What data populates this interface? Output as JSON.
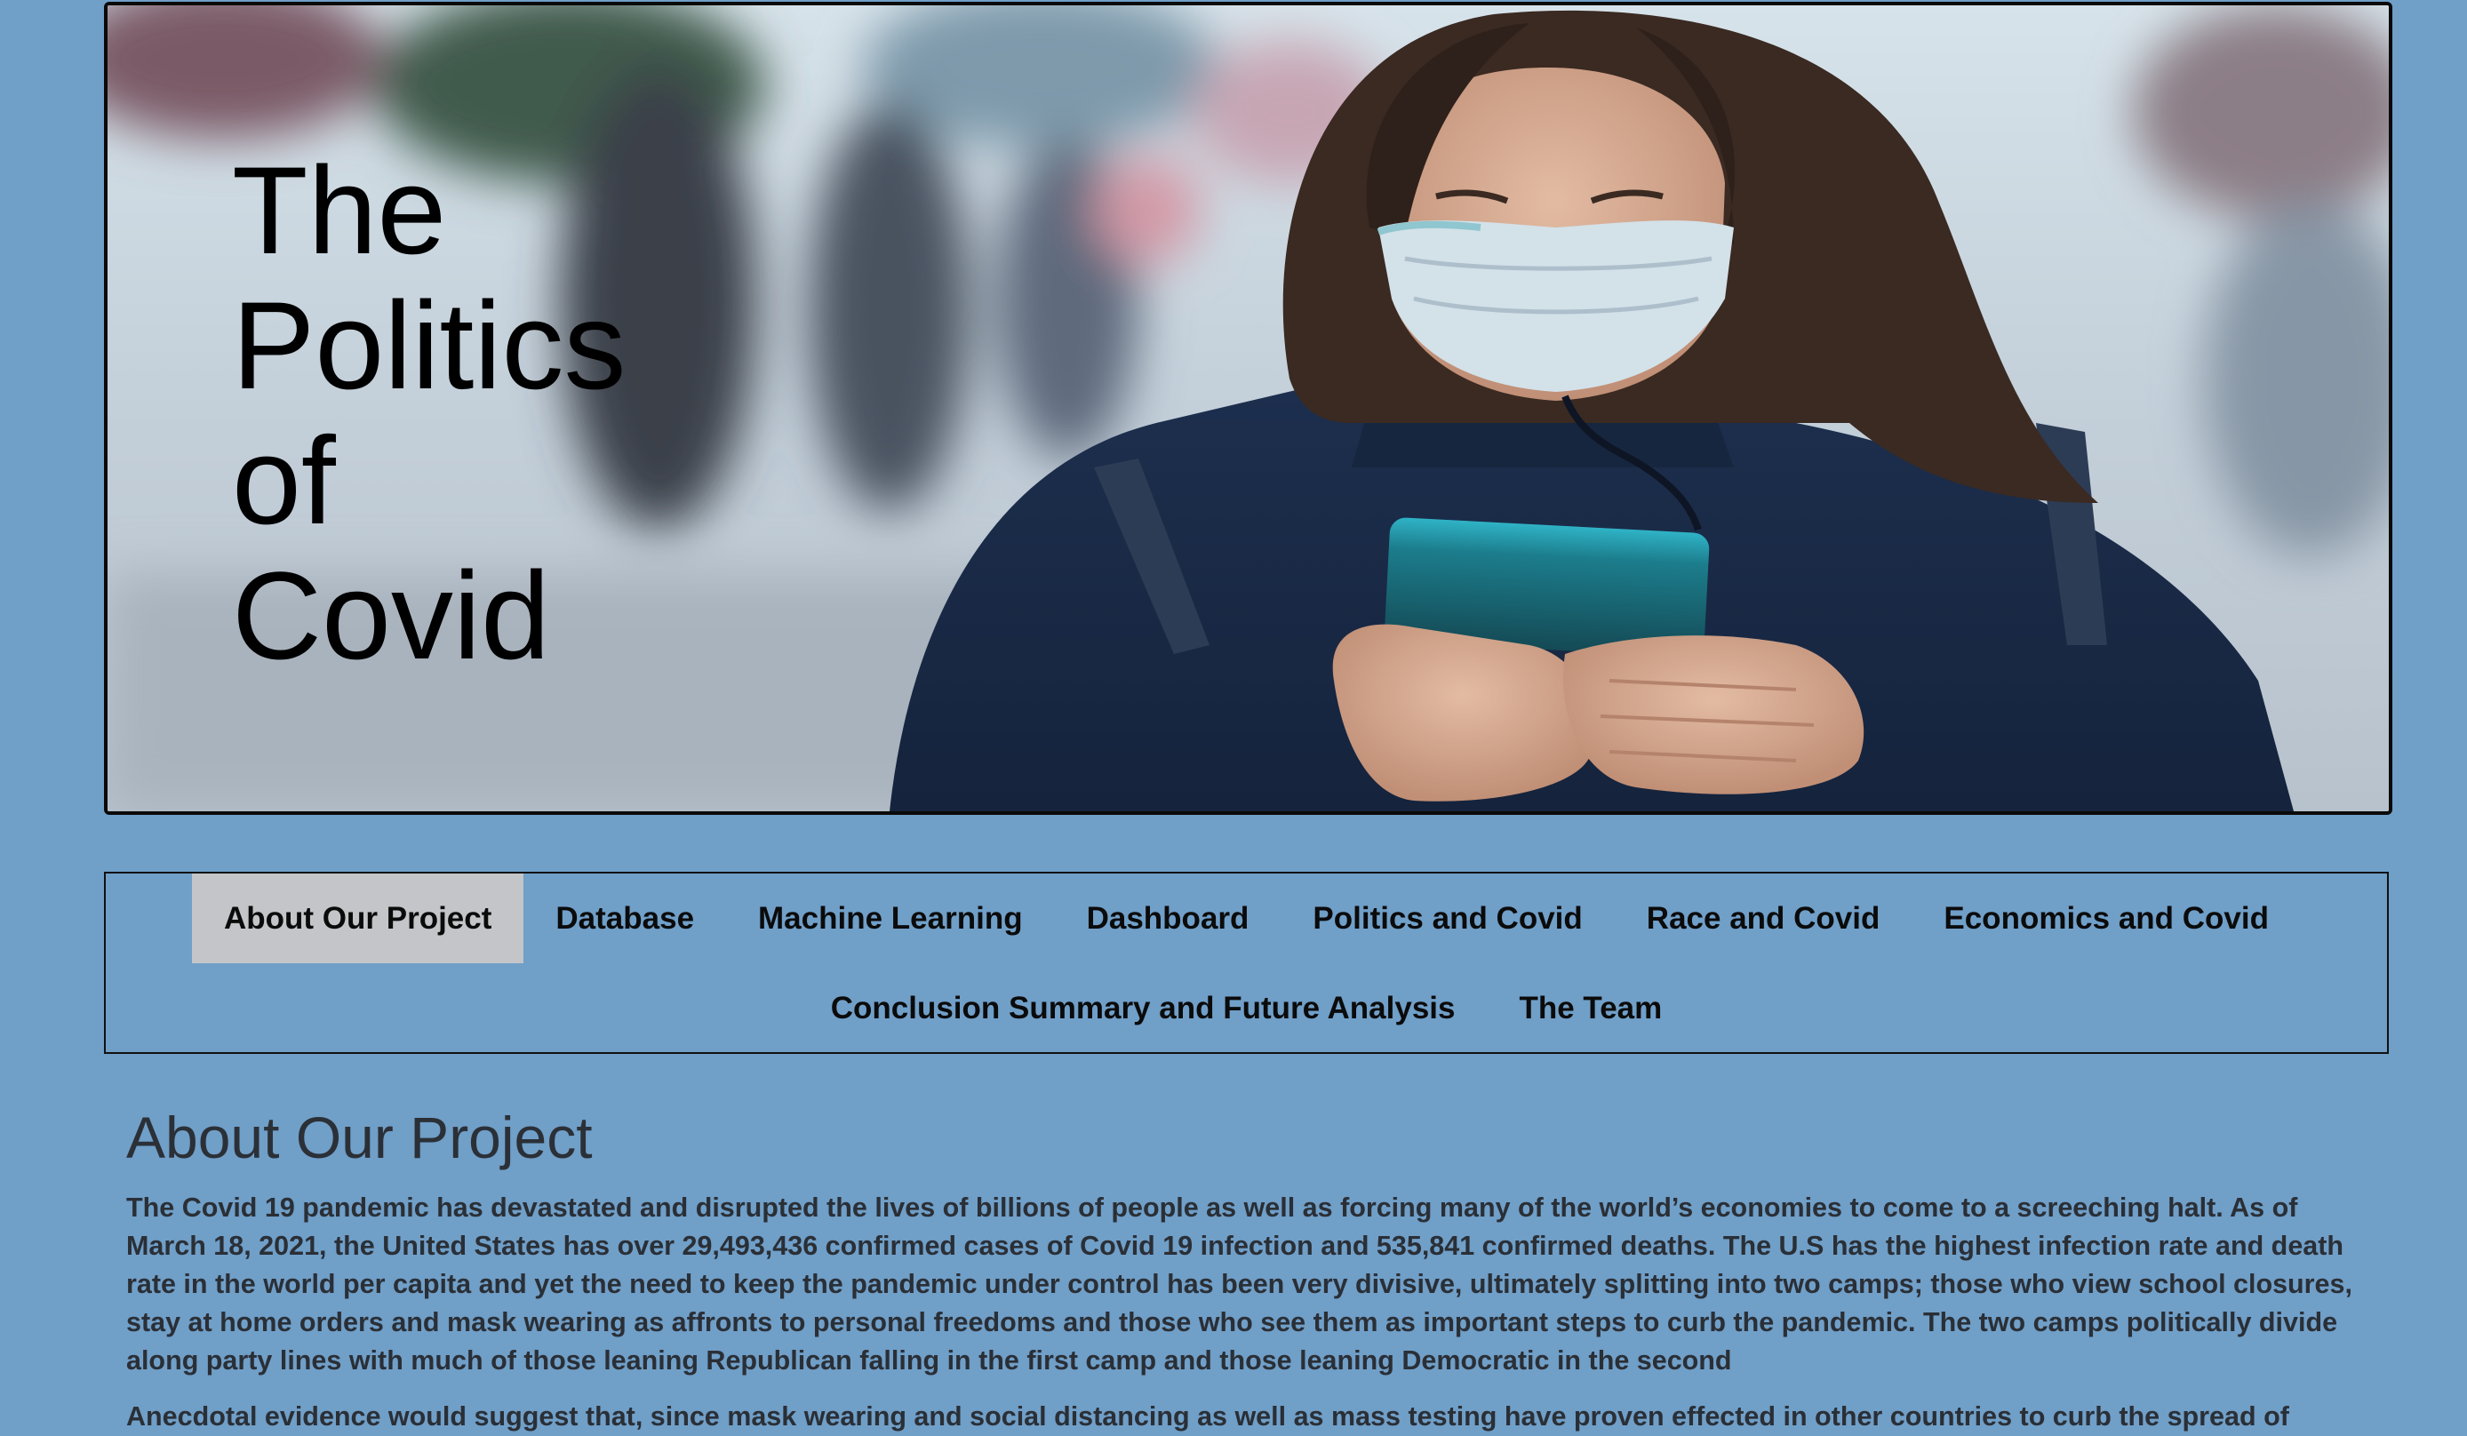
{
  "hero": {
    "title_lines": [
      "The",
      "Politics",
      "of",
      "Covid"
    ]
  },
  "nav": {
    "items": [
      {
        "label": "About Our Project",
        "active": true
      },
      {
        "label": "Database"
      },
      {
        "label": "Machine Learning"
      },
      {
        "label": "Dashboard"
      },
      {
        "label": "Politics and Covid"
      },
      {
        "label": "Race and Covid"
      },
      {
        "label": "Economics and Covid"
      },
      {
        "label": "Conclusion Summary and Future Analysis"
      },
      {
        "label": "The Team"
      }
    ]
  },
  "content": {
    "heading": "About Our Project",
    "paragraphs": [
      "The Covid 19 pandemic has devastated and disrupted the lives of billions of people as well as forcing many of the world’s economies to come to a screeching halt. As of March 18, 2021, the United States has over 29,493,436 confirmed cases of Covid 19 infection and 535,841 confirmed deaths. The U.S has the highest infection rate and death rate in the world per capita and yet the need to keep the pandemic under control has been very divisive, ultimately splitting into two camps; those who view school closures, stay at home orders and mask wearing as affronts to personal freedoms and those who see them as important steps to curb the pandemic. The two camps politically divide along party lines with much of those leaning Republican falling in the first camp and those leaning Democratic in the second",
      "Anecdotal evidence would suggest that, since mask wearing and social distancing as well as mass testing have proven effected in other countries to curb the spread of"
    ]
  },
  "colors": {
    "page_background": "#709fc8",
    "nav_active": "#c3c5c8",
    "text": "#2a2f36"
  }
}
